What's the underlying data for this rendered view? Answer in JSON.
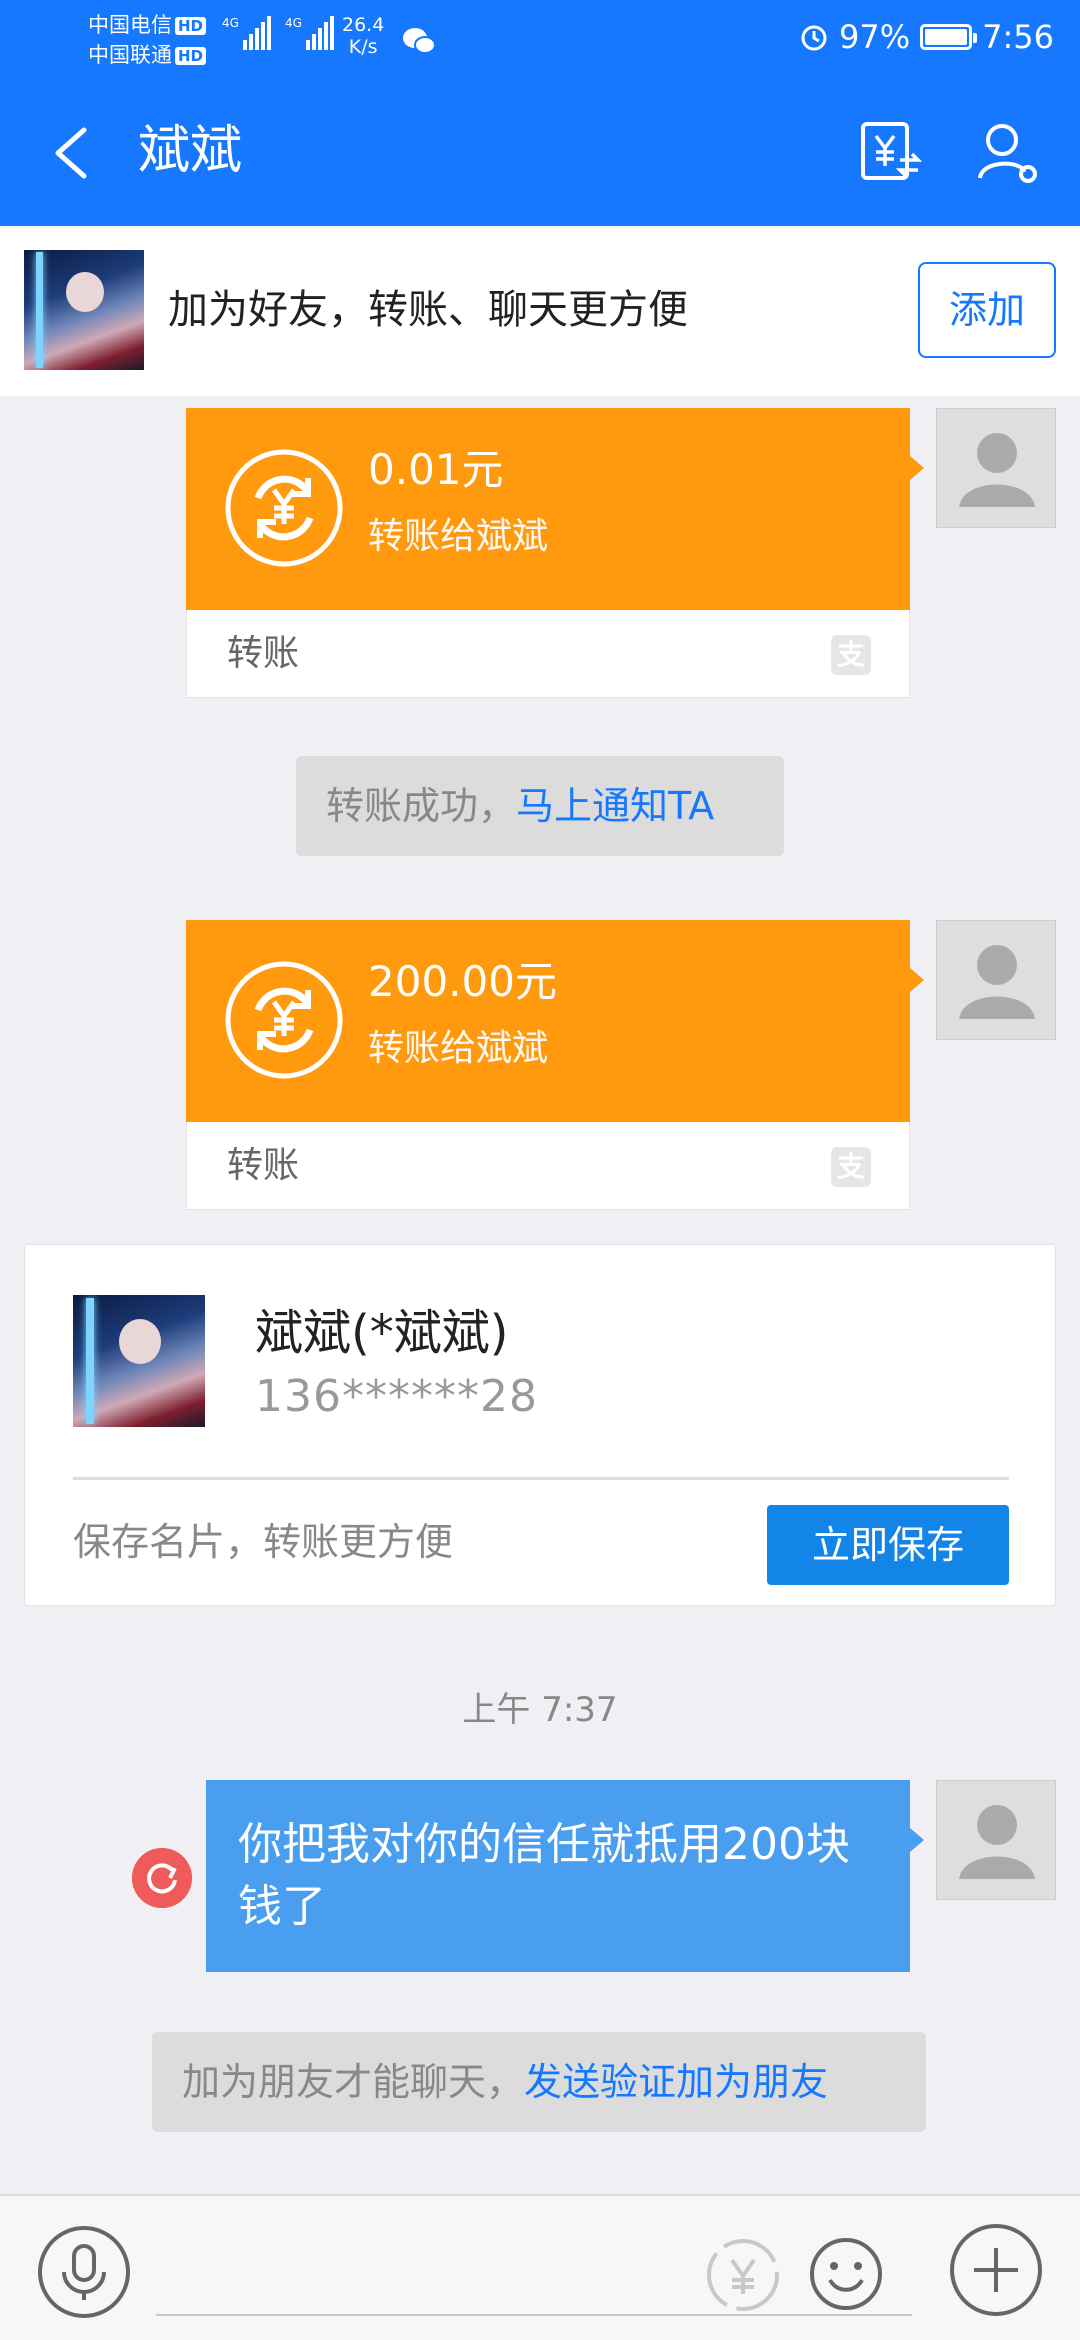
{
  "status_bar": {
    "carrier1": "中国电信",
    "carrier2": "中国联通",
    "hd": "HD",
    "net1": "4G",
    "net2": "4G",
    "speed_value": "26.4",
    "speed_unit": "K/s",
    "battery": "97%",
    "time": "7:56"
  },
  "nav": {
    "title": "斌斌"
  },
  "add_bar": {
    "text": "加为好友，转账、聊天更方便",
    "button": "添加"
  },
  "transfers": [
    {
      "amount": "0.01元",
      "desc": "转账给斌斌",
      "label": "转账",
      "alipay_glyph": "支"
    },
    {
      "amount": "200.00元",
      "desc": "转账给斌斌",
      "label": "转账",
      "alipay_glyph": "支"
    }
  ],
  "notice1": {
    "text": "转账成功，",
    "link": "马上通知TA"
  },
  "contact_card": {
    "name": "斌斌(*斌斌)",
    "phone": "136******28",
    "tip": "保存名片，转账更方便",
    "button": "立即保存"
  },
  "timestamp": "上午 7:37",
  "message": {
    "text": "你把我对你的信任就抵用200块钱了"
  },
  "notice2": {
    "text": "加为朋友才能聊天，",
    "link": "发送验证加为朋友"
  },
  "colors": {
    "brand_blue": "#1677ff",
    "transfer_orange": "#ff9a0e",
    "message_blue": "#4a9eef",
    "retry_red": "#ef5b5b"
  },
  "icons": [
    "back-arrow-icon",
    "transfer-bill-icon",
    "profile-settings-icon",
    "yuan-exchange-icon",
    "alipay-icon",
    "default-avatar-icon",
    "retry-icon",
    "microphone-icon",
    "yuan-icon",
    "emoji-icon",
    "plus-icon",
    "alarm-icon",
    "wechat-icon",
    "battery-icon",
    "signal-icon"
  ]
}
